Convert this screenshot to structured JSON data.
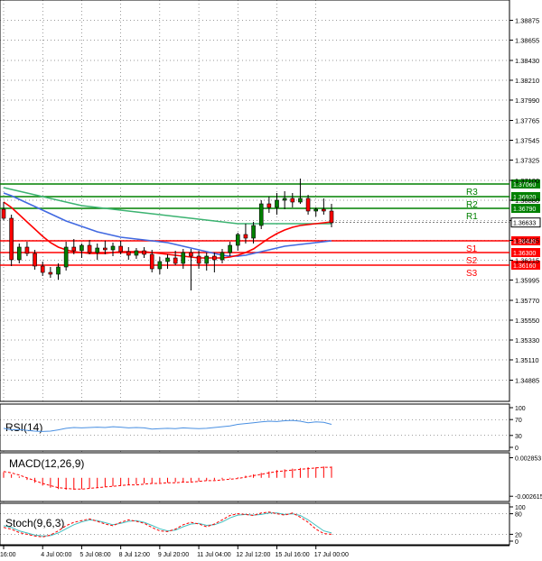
{
  "chart_data": {
    "type": "candlestick",
    "main": {
      "ylim": [
        1.3465,
        1.391
      ],
      "y_ticks": [
        1.38875,
        1.38655,
        1.3843,
        1.3821,
        1.3799,
        1.37765,
        1.37545,
        1.37325,
        1.371,
        1.3688,
        1.36655,
        1.36435,
        1.36215,
        1.35995,
        1.3577,
        1.3555,
        1.3533,
        1.3511,
        1.34885
      ],
      "y_tick_labels": [
        "1.38875",
        "1.38655",
        "1.38430",
        "1.38210",
        "1.37990",
        "1.37765",
        "1.37545",
        "1.37325",
        "1.37100",
        "1.36880",
        "1.36655",
        "1.36435",
        "1.36215",
        "1.35995",
        "1.35770",
        "1.35550",
        "1.35330",
        "1.35110",
        "1.34885"
      ],
      "last_price": 1.36633,
      "last_price_label": "1.36633",
      "candles": [
        {
          "o": 1.3678,
          "h": 1.3686,
          "l": 1.3666,
          "c": 1.3668
        },
        {
          "o": 1.3668,
          "h": 1.3672,
          "l": 1.3615,
          "c": 1.3622
        },
        {
          "o": 1.3622,
          "h": 1.364,
          "l": 1.3618,
          "c": 1.3636
        },
        {
          "o": 1.3636,
          "h": 1.3642,
          "l": 1.3626,
          "c": 1.3629
        },
        {
          "o": 1.3629,
          "h": 1.3633,
          "l": 1.3611,
          "c": 1.3615
        },
        {
          "o": 1.3615,
          "h": 1.362,
          "l": 1.3604,
          "c": 1.3608
        },
        {
          "o": 1.3608,
          "h": 1.3614,
          "l": 1.3602,
          "c": 1.3606
        },
        {
          "o": 1.3606,
          "h": 1.3618,
          "l": 1.36,
          "c": 1.3614
        },
        {
          "o": 1.3614,
          "h": 1.3642,
          "l": 1.361,
          "c": 1.3636
        },
        {
          "o": 1.3636,
          "h": 1.3645,
          "l": 1.3628,
          "c": 1.3632
        },
        {
          "o": 1.3632,
          "h": 1.364,
          "l": 1.3624,
          "c": 1.3638
        },
        {
          "o": 1.3638,
          "h": 1.3644,
          "l": 1.3628,
          "c": 1.363
        },
        {
          "o": 1.363,
          "h": 1.364,
          "l": 1.3622,
          "c": 1.3635
        },
        {
          "o": 1.3635,
          "h": 1.3643,
          "l": 1.3628,
          "c": 1.3633
        },
        {
          "o": 1.3633,
          "h": 1.3641,
          "l": 1.3626,
          "c": 1.3637
        },
        {
          "o": 1.3637,
          "h": 1.3643,
          "l": 1.3628,
          "c": 1.3631
        },
        {
          "o": 1.3631,
          "h": 1.3636,
          "l": 1.3622,
          "c": 1.3627
        },
        {
          "o": 1.3627,
          "h": 1.3635,
          "l": 1.3623,
          "c": 1.3632
        },
        {
          "o": 1.3632,
          "h": 1.3636,
          "l": 1.3624,
          "c": 1.3628
        },
        {
          "o": 1.3628,
          "h": 1.3633,
          "l": 1.3608,
          "c": 1.3612
        },
        {
          "o": 1.3612,
          "h": 1.3625,
          "l": 1.3606,
          "c": 1.362
        },
        {
          "o": 1.362,
          "h": 1.3628,
          "l": 1.3612,
          "c": 1.3624
        },
        {
          "o": 1.3624,
          "h": 1.3632,
          "l": 1.3616,
          "c": 1.3618
        },
        {
          "o": 1.3618,
          "h": 1.3634,
          "l": 1.3612,
          "c": 1.363
        },
        {
          "o": 1.363,
          "h": 1.3634,
          "l": 1.3588,
          "c": 1.3626
        },
        {
          "o": 1.3626,
          "h": 1.3632,
          "l": 1.3612,
          "c": 1.3618
        },
        {
          "o": 1.3618,
          "h": 1.363,
          "l": 1.361,
          "c": 1.3626
        },
        {
          "o": 1.3626,
          "h": 1.363,
          "l": 1.3608,
          "c": 1.3622
        },
        {
          "o": 1.3622,
          "h": 1.3634,
          "l": 1.3618,
          "c": 1.363
        },
        {
          "o": 1.363,
          "h": 1.3642,
          "l": 1.3626,
          "c": 1.3638
        },
        {
          "o": 1.3638,
          "h": 1.3652,
          "l": 1.3632,
          "c": 1.365
        },
        {
          "o": 1.365,
          "h": 1.3662,
          "l": 1.364,
          "c": 1.3646
        },
        {
          "o": 1.3646,
          "h": 1.3664,
          "l": 1.364,
          "c": 1.366
        },
        {
          "o": 1.366,
          "h": 1.3688,
          "l": 1.3656,
          "c": 1.3684
        },
        {
          "o": 1.3684,
          "h": 1.3692,
          "l": 1.3674,
          "c": 1.368
        },
        {
          "o": 1.368,
          "h": 1.3696,
          "l": 1.3672,
          "c": 1.3688
        },
        {
          "o": 1.3688,
          "h": 1.3698,
          "l": 1.3678,
          "c": 1.369
        },
        {
          "o": 1.369,
          "h": 1.3696,
          "l": 1.368,
          "c": 1.3686
        },
        {
          "o": 1.3686,
          "h": 1.3712,
          "l": 1.3684,
          "c": 1.369
        },
        {
          "o": 1.369,
          "h": 1.3694,
          "l": 1.3672,
          "c": 1.3676
        },
        {
          "o": 1.3676,
          "h": 1.368,
          "l": 1.367,
          "c": 1.3678
        },
        {
          "o": 1.3678,
          "h": 1.369,
          "l": 1.3672,
          "c": 1.3676
        },
        {
          "o": 1.3676,
          "h": 1.3684,
          "l": 1.3658,
          "c": 1.3663
        }
      ],
      "ma_fast": [
        1.3686,
        1.368,
        1.3672,
        1.3664,
        1.3656,
        1.3648,
        1.3641,
        1.3636,
        1.3633,
        1.3631,
        1.363,
        1.3629,
        1.3629,
        1.3629,
        1.363,
        1.3631,
        1.3631,
        1.3631,
        1.3631,
        1.363,
        1.3629,
        1.3628,
        1.3627,
        1.3626,
        1.3625,
        1.3624,
        1.3624,
        1.3624,
        1.3624,
        1.3625,
        1.3627,
        1.363,
        1.3634,
        1.364,
        1.3646,
        1.3651,
        1.3655,
        1.3658,
        1.366,
        1.3661,
        1.3662,
        1.3663,
        1.3664
      ],
      "ma_mid": [
        1.3696,
        1.3693,
        1.3689,
        1.3685,
        1.3681,
        1.3677,
        1.3673,
        1.3669,
        1.3665,
        1.3662,
        1.3659,
        1.3656,
        1.3653,
        1.3651,
        1.3649,
        1.3647,
        1.3646,
        1.3645,
        1.3644,
        1.3643,
        1.3642,
        1.3641,
        1.3639,
        1.3637,
        1.3635,
        1.3633,
        1.3631,
        1.3629,
        1.3627,
        1.3626,
        1.3626,
        1.3627,
        1.3629,
        1.3631,
        1.3633,
        1.3635,
        1.3637,
        1.3638,
        1.3639,
        1.364,
        1.3641,
        1.3642,
        1.3643
      ],
      "ma_slow": [
        1.3702,
        1.37,
        1.3698,
        1.3696,
        1.3694,
        1.3692,
        1.369,
        1.3688,
        1.3686,
        1.3684,
        1.3682,
        1.3681,
        1.368,
        1.3679,
        1.3678,
        1.3677,
        1.3676,
        1.3675,
        1.3674,
        1.3673,
        1.3672,
        1.3671,
        1.367,
        1.3669,
        1.3668,
        1.3667,
        1.3666,
        1.3665,
        1.3664,
        1.3663,
        1.3662,
        1.3662,
        1.3662,
        1.3662,
        1.3662,
        1.3662,
        1.3662,
        1.3662,
        1.3662,
        1.3662,
        1.3662,
        1.3662,
        1.3662
      ],
      "levels": [
        {
          "name": "R3",
          "value": 1.3706,
          "label": "1.37060",
          "color": "#008000"
        },
        {
          "name": "R2",
          "value": 1.3692,
          "label": "1.36920",
          "color": "#008000"
        },
        {
          "name": "R1",
          "value": 1.3679,
          "label": "1.36790",
          "color": "#008000"
        },
        {
          "name": "S1",
          "value": 1.3643,
          "label": "1.36430",
          "color": "#ff0000"
        },
        {
          "name": "S2",
          "value": 1.363,
          "label": "1.36300",
          "color": "#ff0000"
        },
        {
          "name": "S3",
          "value": 1.3616,
          "label": "1.36160",
          "color": "#ff0000"
        }
      ]
    },
    "rsi": {
      "label": "RSI(14)",
      "ylim": [
        0,
        100
      ],
      "y_ticks": [
        100,
        70,
        30,
        0
      ],
      "y_tick_labels": [
        "100",
        "70",
        "30",
        "0"
      ],
      "values": [
        48,
        44,
        45,
        43,
        41,
        40,
        41,
        44,
        48,
        50,
        49,
        50,
        51,
        50,
        52,
        51,
        49,
        50,
        49,
        46,
        47,
        48,
        47,
        49,
        48,
        47,
        48,
        50,
        52,
        54,
        58,
        60,
        62,
        64,
        66,
        65,
        67,
        68,
        66,
        62,
        64,
        63,
        58
      ]
    },
    "macd": {
      "label": "MACD(12,26,9)",
      "ylim": [
        -0.0031,
        0.0033
      ],
      "y_ticks": [
        0.002853,
        -0.002615
      ],
      "y_tick_labels": [
        "0.002853",
        "-0.002615"
      ],
      "hist": [
        0.0008,
        0.0005,
        0.0002,
        -0.0003,
        -0.0007,
        -0.0011,
        -0.0014,
        -0.0016,
        -0.0017,
        -0.0017,
        -0.0016,
        -0.0015,
        -0.0014,
        -0.0013,
        -0.0012,
        -0.0011,
        -0.001,
        -0.0009,
        -0.0008,
        -0.0008,
        -0.0007,
        -0.0007,
        -0.0006,
        -0.0006,
        -0.0005,
        -0.0005,
        -0.0004,
        -0.0003,
        -0.0002,
        -0.0001,
        0.0001,
        0.0003,
        0.0005,
        0.0007,
        0.0009,
        0.0011,
        0.0012,
        0.0013,
        0.0014,
        0.0015,
        0.0015,
        0.0016,
        0.0016
      ],
      "signal": [
        0.0009,
        0.0007,
        0.0004,
        0.0,
        -0.0004,
        -0.0008,
        -0.0011,
        -0.0014,
        -0.0015,
        -0.0016,
        -0.0016,
        -0.0015,
        -0.0014,
        -0.0013,
        -0.0012,
        -0.0011,
        -0.001,
        -0.001,
        -0.0009,
        -0.0008,
        -0.0008,
        -0.0007,
        -0.0007,
        -0.0006,
        -0.0006,
        -0.0005,
        -0.0004,
        -0.0004,
        -0.0003,
        -0.0002,
        -0.0001,
        0.0001,
        0.0003,
        0.0005,
        0.0007,
        0.0009,
        0.001,
        0.0011,
        0.0012,
        0.0013,
        0.0014,
        0.0015,
        0.0015
      ]
    },
    "stoch": {
      "label": "Stoch(9,6,3)",
      "ylim": [
        0,
        100
      ],
      "y_ticks": [
        100,
        80,
        20,
        0
      ],
      "y_tick_labels": [
        "100",
        "80",
        "20",
        "0"
      ],
      "k": [
        40,
        35,
        25,
        20,
        15,
        12,
        18,
        30,
        45,
        55,
        60,
        65,
        58,
        50,
        45,
        55,
        62,
        58,
        52,
        40,
        30,
        28,
        35,
        48,
        55,
        50,
        42,
        50,
        62,
        75,
        80,
        78,
        75,
        82,
        85,
        80,
        76,
        82,
        70,
        55,
        35,
        22,
        20
      ],
      "d": [
        45,
        40,
        30,
        24,
        18,
        15,
        16,
        24,
        36,
        48,
        56,
        62,
        60,
        54,
        48,
        52,
        58,
        60,
        55,
        46,
        36,
        30,
        32,
        42,
        50,
        52,
        46,
        48,
        56,
        68,
        76,
        78,
        76,
        78,
        82,
        82,
        78,
        80,
        75,
        62,
        46,
        30,
        24
      ]
    },
    "x_tick_labels": [
      "16:00",
      "4 Jul 00:00",
      "5 Jul 08:00",
      "8 Jul 12:00",
      "9 Jul 20:00",
      "11 Jul 04:00",
      "12 Jul 12:00",
      "15 Jul 16:00",
      "17 Jul 00:00"
    ],
    "colors": {
      "bull": "#008000",
      "bear": "#ff0000",
      "ma_fast": "#ff0000",
      "ma_mid": "#4169e1",
      "ma_slow": "#3cb371",
      "rsi": "#4a90e2",
      "macd_hist": "#ff0000",
      "macd_signal": "#ff0000",
      "stoch_k": "#ff0000",
      "stoch_d": "#40c0c0",
      "current_price_box": "#000000",
      "grid": "#000000"
    }
  }
}
